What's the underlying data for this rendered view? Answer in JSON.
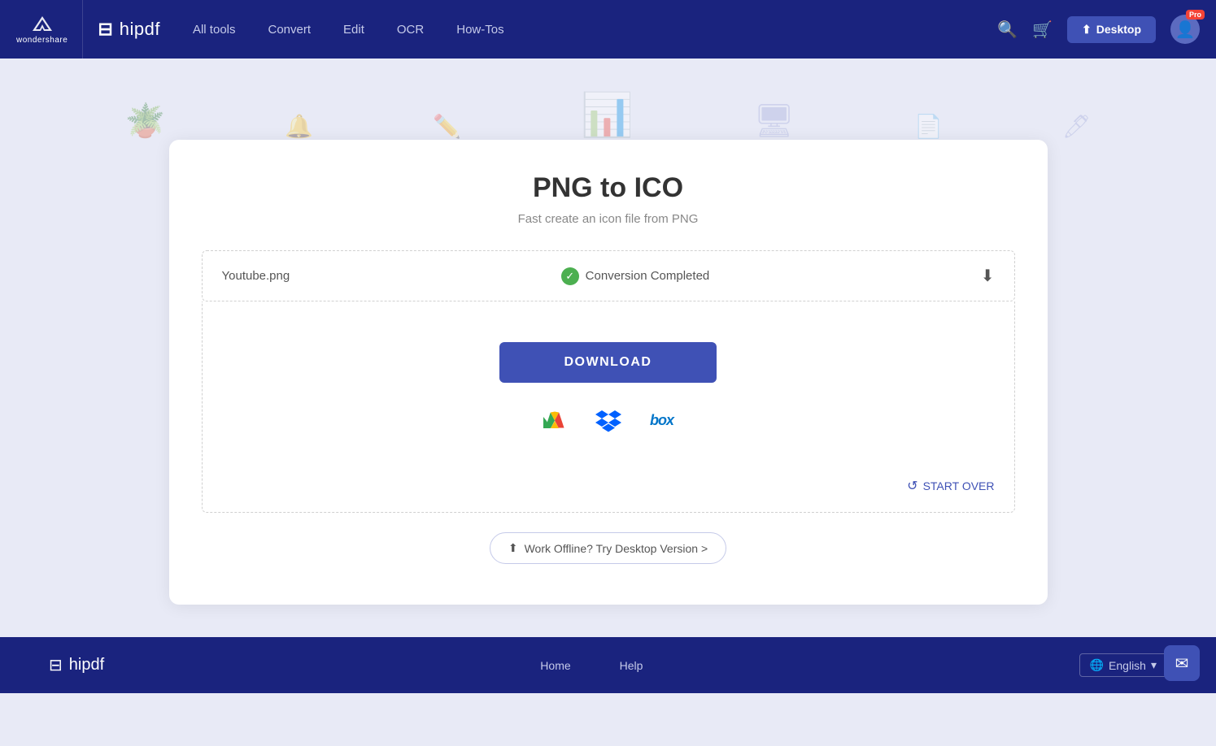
{
  "nav": {
    "wondershare_label": "wondershare",
    "hipdf_label": "hipdf",
    "links": [
      {
        "id": "all-tools",
        "label": "All tools"
      },
      {
        "id": "convert",
        "label": "Convert"
      },
      {
        "id": "edit",
        "label": "Edit"
      },
      {
        "id": "ocr",
        "label": "OCR"
      },
      {
        "id": "how-tos",
        "label": "How-Tos"
      }
    ],
    "desktop_btn_label": "Desktop",
    "pro_badge": "Pro"
  },
  "page": {
    "title": "PNG to ICO",
    "subtitle": "Fast create an icon file from PNG"
  },
  "file": {
    "name": "Youtube.png",
    "status": "Conversion Completed"
  },
  "actions": {
    "download_label": "DOWNLOAD",
    "start_over_label": "START OVER",
    "desktop_banner_label": "Work Offline? Try Desktop Version >"
  },
  "cloud_services": [
    {
      "id": "google-drive",
      "label": "Google Drive"
    },
    {
      "id": "dropbox",
      "label": "Dropbox"
    },
    {
      "id": "box",
      "label": "Box"
    }
  ],
  "footer": {
    "hipdf_label": "hipdf",
    "links": [
      {
        "id": "home",
        "label": "Home"
      },
      {
        "id": "help",
        "label": "Help"
      }
    ],
    "lang_label": "English"
  }
}
